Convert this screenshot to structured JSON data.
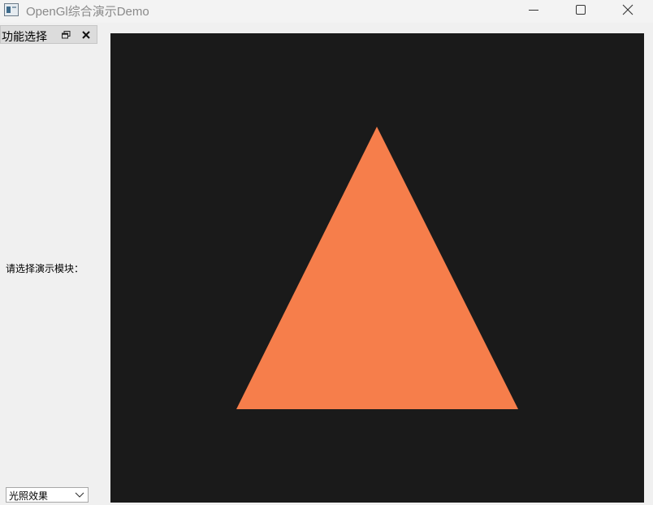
{
  "window": {
    "title": "OpenGl综合演示Demo",
    "icon": "app-window-icon",
    "controls": [
      "minimize-icon",
      "maximize-icon",
      "close-icon"
    ]
  },
  "dock": {
    "title": "功能选择",
    "float_icon": "dock-float-icon",
    "close_icon": "dock-close-icon",
    "prompt": "请选择演示模块：",
    "module_select": {
      "selected": "光照效果",
      "icon": "chevron-down-icon"
    }
  },
  "viewport": {
    "background_color": "#1a1a1a",
    "shape": "triangle",
    "shape_color": "#f67e4b"
  }
}
